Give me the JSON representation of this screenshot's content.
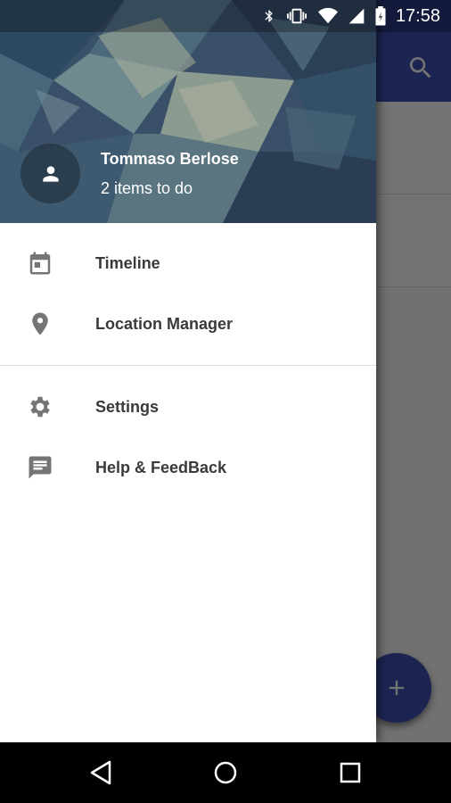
{
  "status_bar": {
    "time": "17:58",
    "icons": [
      "bluetooth-icon",
      "vibrate-icon",
      "wifi-icon",
      "signal-icon",
      "battery-icon"
    ]
  },
  "drawer": {
    "header": {
      "user_name": "Tommaso Berlose",
      "subtitle": "2 items to do",
      "avatar_icon": "person-icon"
    },
    "primary_items": [
      {
        "label": "Timeline",
        "icon": "calendar-icon"
      },
      {
        "label": "Location Manager",
        "icon": "location-pin-icon"
      }
    ],
    "secondary_items": [
      {
        "label": "Settings",
        "icon": "gear-icon"
      },
      {
        "label": "Help & FeedBack",
        "icon": "feedback-icon"
      }
    ]
  },
  "background_app": {
    "toolbar_icon": "search-icon",
    "fab_icon": "plus-icon"
  },
  "nav_bar": {
    "buttons": [
      "back-icon",
      "home-icon",
      "recents-icon"
    ]
  },
  "colors": {
    "primary": "#3f51b5",
    "drawer_text": "#3a3a3a",
    "icon_grey": "#757575"
  }
}
